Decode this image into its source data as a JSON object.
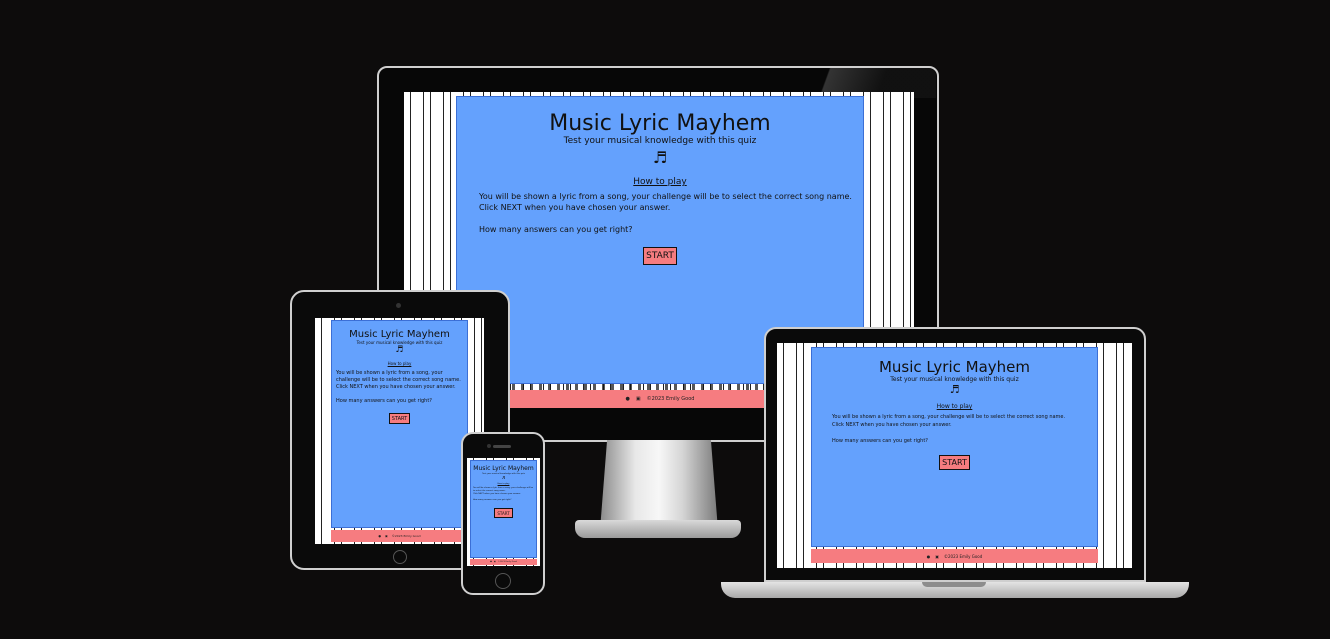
{
  "site": {
    "title": "Music Lyric Mayhem",
    "tagline": "Test your musical knowledge with this quiz",
    "note_icon": "music-note-icon",
    "note_glyph": "♬",
    "how_heading": "How to play",
    "instructions_1": "You will be shown a lyric from a song, your challenge will be to select the correct song name.",
    "instructions_2": "Click NEXT when you have chosen your answer.",
    "question": "How many answers can you get right?",
    "start_label": "START",
    "footer_text": "©2023 Emily Good",
    "footer_icons": [
      "github-icon",
      "linkedin-icon"
    ]
  },
  "colors": {
    "background": "#0d0c0c",
    "panel": "#64a1fd",
    "accent": "#f67c80"
  }
}
